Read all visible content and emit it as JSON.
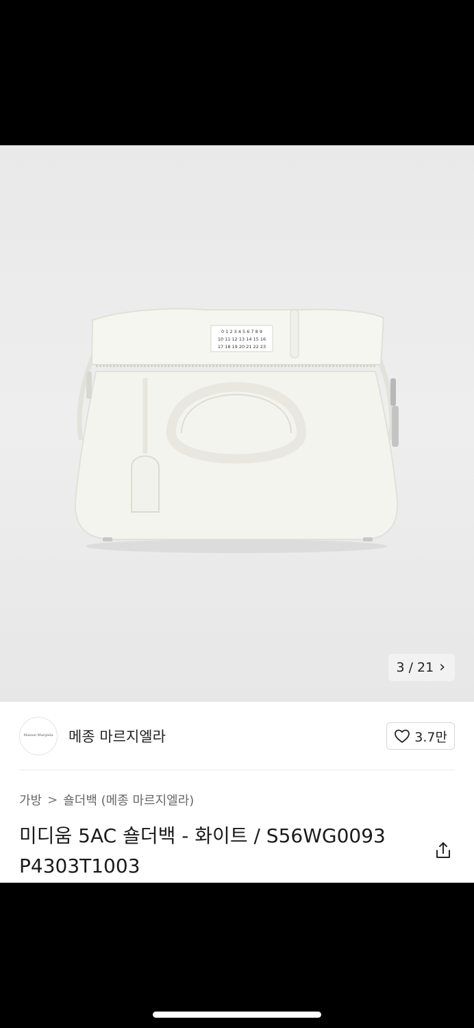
{
  "gallery": {
    "image_alt": "product-photo",
    "pager": {
      "current": "3",
      "separator": "/",
      "total": "21",
      "next_icon": "chevron-right-icon"
    },
    "bag_label_lines": [
      "0 1 2 3 4 5 6 7 8 9",
      "10 11 12 13 14 15 16",
      "17 18 19 20 21 22 23"
    ]
  },
  "brand": {
    "logo_text": "Maison Margiela",
    "name": "메종 마르지엘라",
    "likes": "3.7만",
    "like_icon": "heart-outline-icon"
  },
  "breadcrumb": {
    "level1": "가방",
    "separator": ">",
    "level2": "숄더백 (메종 마르지엘라)"
  },
  "product": {
    "title_line1": "미디움 5AC 숄더백 - 화이트 / S56WG0093",
    "title_line2": "P4303T1003",
    "share_icon": "share-icon"
  },
  "colors": {
    "background": "#000000",
    "gallery_bg": "#ececec",
    "text": "#1a1a1a"
  }
}
